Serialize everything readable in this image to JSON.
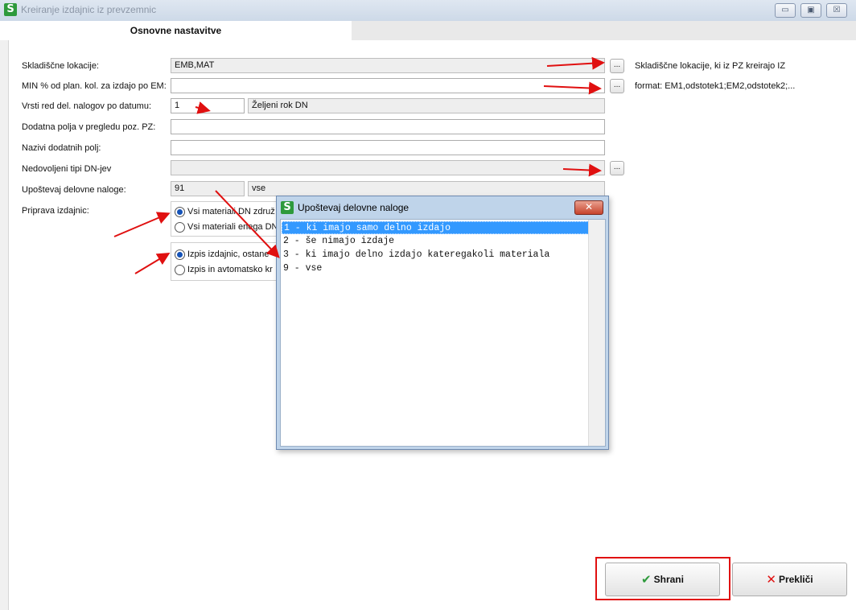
{
  "window": {
    "title": "Kreiranje izdajnic iz prevzemnic",
    "logo_letter": "S",
    "controls": {
      "minimize": "▭",
      "maximize": "▣",
      "close": "☒"
    }
  },
  "tabs": [
    {
      "label": "Osnovne nastavitve"
    }
  ],
  "form": {
    "skladiscne_lokacije": {
      "label": "Skladiščne lokacije:",
      "value": "EMB,MAT",
      "hint": "Skladiščne lokacije, ki iz PZ kreirajo IZ"
    },
    "min_procent": {
      "label": "MIN % od plan. kol. za izdajo po EM:",
      "value": "",
      "hint": "format: EM1,odstotek1;EM2,odstotek2;..."
    },
    "vrsti_red": {
      "label": "Vrsti red del. nalogov po datumu:",
      "value": "1",
      "desc": "Željeni rok DN"
    },
    "dodatna_polja": {
      "label": "Dodatna polja v pregledu poz. PZ:",
      "value": ""
    },
    "nazivi_polj": {
      "label": "Nazivi dodatnih polj:",
      "value": ""
    },
    "nedovoljeni_tipi": {
      "label": "Nedovoljeni tipi DN-jev",
      "value": ""
    },
    "upostevaj": {
      "label": "Upoštevaj delovne naloge:",
      "value": "91",
      "desc": "vse"
    },
    "priprava": {
      "label": "Priprava izdajnic:",
      "options": [
        "Vsi materiali DN združ",
        "Vsi materiali enega DN"
      ],
      "selected": 0
    },
    "izpis": {
      "options": [
        "Izpis izdajnic, ostane",
        "Izpis in avtomatsko kr"
      ],
      "selected": 0
    },
    "dots_label": "..."
  },
  "dialog": {
    "title": "Upoštevaj delovne naloge",
    "close_label": "✕",
    "items": [
      "1 - ki imajo samo delno izdajo",
      "2 - še nimajo izdaje",
      "3 - ki imajo delno izdajo kateregakoli materiala",
      "9 - vse"
    ],
    "selected": 0
  },
  "buttons": {
    "save": {
      "label": "Shrani",
      "icon": "✔"
    },
    "cancel": {
      "label": "Prekliči",
      "icon": "✕"
    }
  },
  "colors": {
    "annotation": "#e01010",
    "selection": "#3399ff",
    "save_icon": "#2e9a3c",
    "cancel_icon": "#e01010"
  }
}
